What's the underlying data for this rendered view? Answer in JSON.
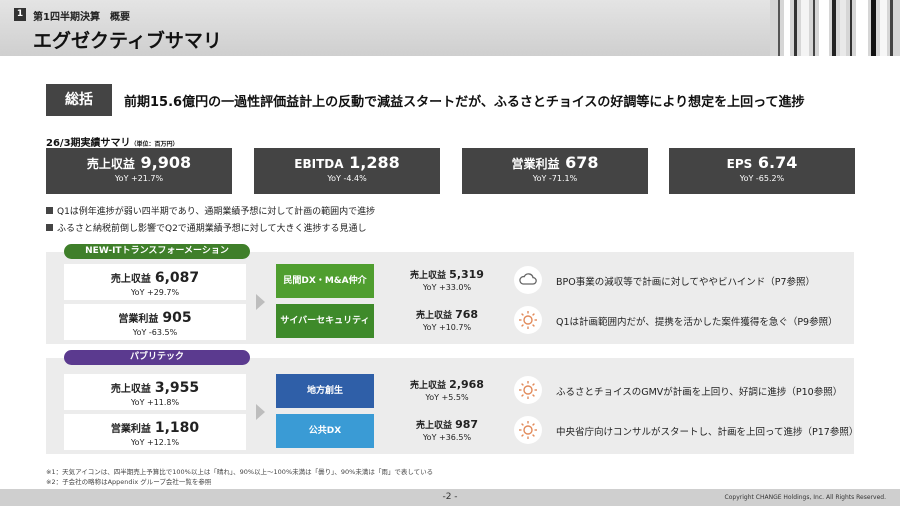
{
  "header": {
    "section_number": "1",
    "section_label": "第1四半期決算　概要",
    "title": "エグゼクティブサマリ"
  },
  "summary": {
    "label": "総括",
    "text": "前期15.6億円の一過性評価益計上の反動で減益スタートだが、ふるさとチョイスの好調等により想定を上回って進捗"
  },
  "kpi_heading": "26/3期実績サマリ",
  "kpi_unit": "（単位：百万円）",
  "kpis": [
    {
      "label": "売上収益",
      "value": "9,908",
      "yoy": "YoY +21.7%"
    },
    {
      "label": "EBITDA",
      "value": "1,288",
      "yoy": "YoY -4.4%"
    },
    {
      "label": "営業利益",
      "value": "678",
      "yoy": "YoY -71.1%"
    },
    {
      "label": "EPS",
      "value": "6.74",
      "yoy": "YoY -65.2%"
    }
  ],
  "notes": [
    "Q1は例年進捗が弱い四半期であり、通期業績予想に対して計画の範囲内で進捗",
    "ふるさと納税前倒し影響でQ2で通期業績予想に対して大きく進捗する見通し"
  ],
  "segments": [
    {
      "name": "NEW-ITトランスフォーメーション",
      "color": "#3f7f2a",
      "cards": [
        {
          "label": "売上収益",
          "value": "6,087",
          "yoy": "YoY +29.7%"
        },
        {
          "label": "営業利益",
          "value": "905",
          "yoy": "YoY -63.5%"
        }
      ],
      "subs": [
        {
          "name": "民間DX・M&A仲介",
          "color": "#4f9e2f",
          "label": "売上収益",
          "value": "5,319",
          "yoy": "YoY +33.0%",
          "icon": "cloud-icon",
          "comment": "BPO事業の減収等で計画に対してややビハインド（P7参照）"
        },
        {
          "name": "サイバーセキュリティ",
          "color": "#3e8a2a",
          "label": "売上収益",
          "value": "768",
          "yoy": "YoY +10.7%",
          "icon": "sun-icon",
          "comment": "Q1は計画範囲内だが、提携を活かした案件獲得を急ぐ（P9参照）"
        }
      ]
    },
    {
      "name": "パブリテック",
      "color": "#5b3a8f",
      "cards": [
        {
          "label": "売上収益",
          "value": "3,955",
          "yoy": "YoY +11.8%"
        },
        {
          "label": "営業利益",
          "value": "1,180",
          "yoy": "YoY +12.1%"
        }
      ],
      "subs": [
        {
          "name": "地方創生",
          "color": "#2f5fa8",
          "label": "売上収益",
          "value": "2,968",
          "yoy": "YoY +5.5%",
          "icon": "sun-icon",
          "comment": "ふるさとチョイスのGMVが計画を上回り、好調に進捗（P10参照）"
        },
        {
          "name": "公共DX",
          "color": "#3a9bd5",
          "label": "売上収益",
          "value": "987",
          "yoy": "YoY +36.5%",
          "icon": "sun-icon",
          "comment": "中央省庁向けコンサルがスタートし、計画を上回って進捗（P17参照）"
        }
      ]
    }
  ],
  "footnotes": [
    "※1：天気アイコンは、四半期売上予算比で100%以上は「晴れ」、90%以上～100%未満は「曇り」、90%未満は「雨」で表している",
    "※2：子会社の略称はAppendix グループ会社一覧を参照"
  ],
  "footer": {
    "page": "-2 -",
    "copyright": "Copyright CHANGE Holdings, Inc. All Rights Reserved."
  }
}
